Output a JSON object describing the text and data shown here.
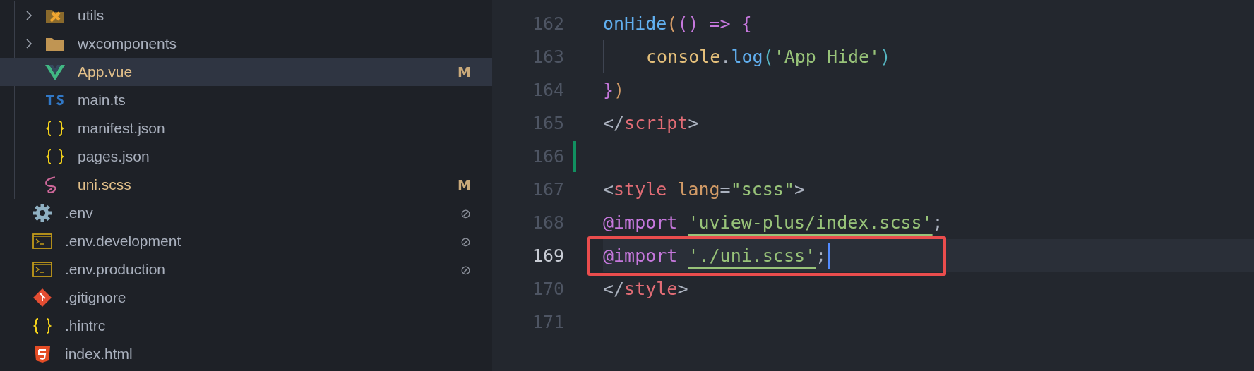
{
  "explorer": {
    "indented_items": [
      {
        "label": "utils",
        "kind": "tools-folder",
        "expanded": false,
        "selected": false,
        "modified": false
      },
      {
        "label": "wxcomponents",
        "kind": "folder",
        "expanded": false,
        "selected": false,
        "modified": false
      },
      {
        "label": "App.vue",
        "kind": "vue",
        "selected": true,
        "modified": true,
        "badge": "M"
      },
      {
        "label": "main.ts",
        "kind": "ts",
        "selected": false,
        "modified": false
      },
      {
        "label": "manifest.json",
        "kind": "json",
        "selected": false,
        "modified": false
      },
      {
        "label": "pages.json",
        "kind": "json",
        "selected": false,
        "modified": false
      },
      {
        "label": "uni.scss",
        "kind": "sass",
        "selected": false,
        "modified": true,
        "badge": "M"
      }
    ],
    "items": [
      {
        "label": ".env",
        "kind": "gear",
        "selected": false,
        "modified": false,
        "badge": "⊘"
      },
      {
        "label": ".env.development",
        "kind": "terminal",
        "selected": false,
        "modified": false,
        "badge": "⊘"
      },
      {
        "label": ".env.production",
        "kind": "terminal",
        "selected": false,
        "modified": false,
        "badge": "⊘"
      },
      {
        "label": ".gitignore",
        "kind": "git",
        "selected": false,
        "modified": false
      },
      {
        "label": ".hintrc",
        "kind": "json",
        "selected": false,
        "modified": false
      },
      {
        "label": "index.html",
        "kind": "html",
        "selected": false,
        "modified": false
      }
    ]
  },
  "editor": {
    "lines": [
      {
        "number": "162",
        "current": false,
        "tokens": [
          {
            "t": "onHide",
            "kind": "function"
          },
          {
            "t": "(",
            "kind": "bracket1"
          },
          {
            "t": "()",
            "kind": "bracket2"
          },
          {
            "t": " => ",
            "kind": "keyword"
          },
          {
            "t": "{",
            "kind": "bracket2"
          }
        ]
      },
      {
        "number": "163",
        "current": false,
        "indented": true,
        "tokens": [
          {
            "t": "console",
            "kind": "variable"
          },
          {
            "t": ".",
            "kind": "plain"
          },
          {
            "t": "log",
            "kind": "function"
          },
          {
            "t": "(",
            "kind": "bracket3"
          },
          {
            "t": "'App Hide'",
            "kind": "string"
          },
          {
            "t": ")",
            "kind": "bracket3"
          }
        ]
      },
      {
        "number": "164",
        "current": false,
        "tokens": [
          {
            "t": "}",
            "kind": "bracket2"
          },
          {
            "t": ")",
            "kind": "bracket1"
          }
        ]
      },
      {
        "number": "165",
        "current": false,
        "tokens": [
          {
            "t": "</",
            "kind": "plain"
          },
          {
            "t": "script",
            "kind": "tag"
          },
          {
            "t": ">",
            "kind": "plain"
          }
        ]
      },
      {
        "number": "166",
        "current": false,
        "added": true
      },
      {
        "number": "167",
        "current": false,
        "tokens": [
          {
            "t": "<",
            "kind": "plain"
          },
          {
            "t": "style ",
            "kind": "tag"
          },
          {
            "t": "lang",
            "kind": "attribute"
          },
          {
            "t": "=",
            "kind": "plain"
          },
          {
            "t": "\"scss\"",
            "kind": "string"
          },
          {
            "t": ">",
            "kind": "plain"
          }
        ]
      },
      {
        "number": "168",
        "current": false,
        "tokens": [
          {
            "t": "@import ",
            "kind": "keyword"
          },
          {
            "t": "'uview-plus/index.scss'",
            "kind": "link-string"
          },
          {
            "t": ";",
            "kind": "plain"
          }
        ]
      },
      {
        "number": "169",
        "current": true,
        "highlighted": true,
        "cursor": true,
        "tokens": [
          {
            "t": "@import ",
            "kind": "keyword"
          },
          {
            "t": "'./uni.scss'",
            "kind": "link-string"
          },
          {
            "t": ";",
            "kind": "plain"
          }
        ]
      },
      {
        "number": "170",
        "current": false,
        "tokens": [
          {
            "t": "</",
            "kind": "plain"
          },
          {
            "t": "style",
            "kind": "tag"
          },
          {
            "t": ">",
            "kind": "plain"
          }
        ]
      },
      {
        "number": "171",
        "current": false
      }
    ]
  }
}
